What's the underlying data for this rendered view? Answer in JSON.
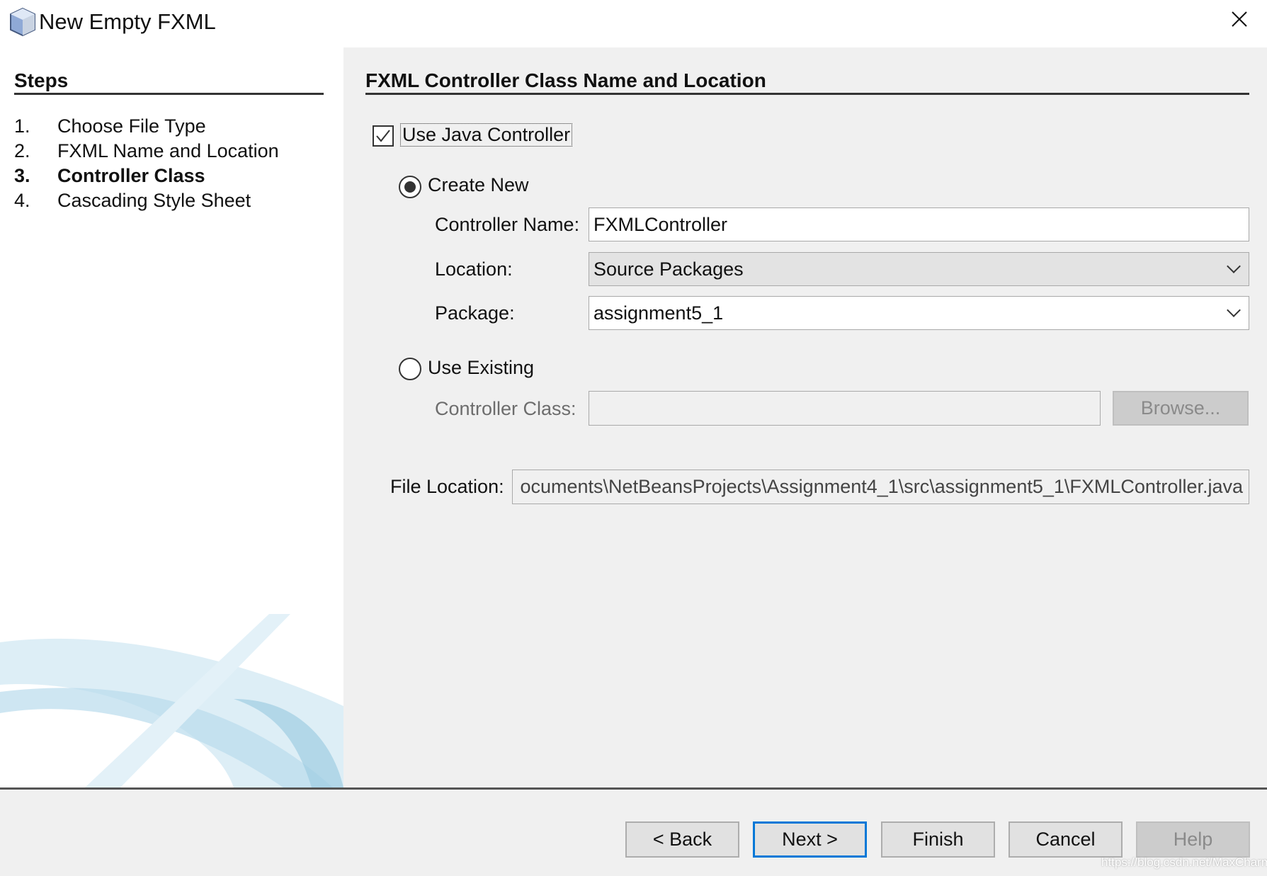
{
  "window": {
    "title": "New Empty FXML",
    "close_icon": "close-icon",
    "app_icon": "cube-icon"
  },
  "steps": {
    "heading": "Steps",
    "items": [
      {
        "num": "1.",
        "label": "Choose File Type",
        "current": false
      },
      {
        "num": "2.",
        "label": "FXML Name and Location",
        "current": false
      },
      {
        "num": "3.",
        "label": "Controller Class",
        "current": true
      },
      {
        "num": "4.",
        "label": "Cascading Style Sheet",
        "current": false
      }
    ]
  },
  "panel": {
    "heading": "FXML Controller Class Name and Location",
    "use_java_controller": {
      "label": "Use Java Controller",
      "checked": true
    },
    "create_new": {
      "label": "Create New",
      "selected": true
    },
    "controller_name": {
      "label": "Controller Name:",
      "value": "FXMLController"
    },
    "location": {
      "label": "Location:",
      "value": "Source Packages"
    },
    "package": {
      "label": "Package:",
      "value": "assignment5_1"
    },
    "use_existing": {
      "label": "Use Existing",
      "selected": false
    },
    "controller_class": {
      "label": "Controller Class:",
      "value": "",
      "browse": "Browse..."
    },
    "file_location": {
      "label": "File Location:",
      "value": "ocuments\\NetBeansProjects\\Assignment4_1\\src\\assignment5_1\\FXMLController.java"
    }
  },
  "footer": {
    "back": "< Back",
    "next": "Next >",
    "finish": "Finish",
    "cancel": "Cancel",
    "help": "Help",
    "watermark": "https://blog.csdn.net/MaxCharm"
  }
}
